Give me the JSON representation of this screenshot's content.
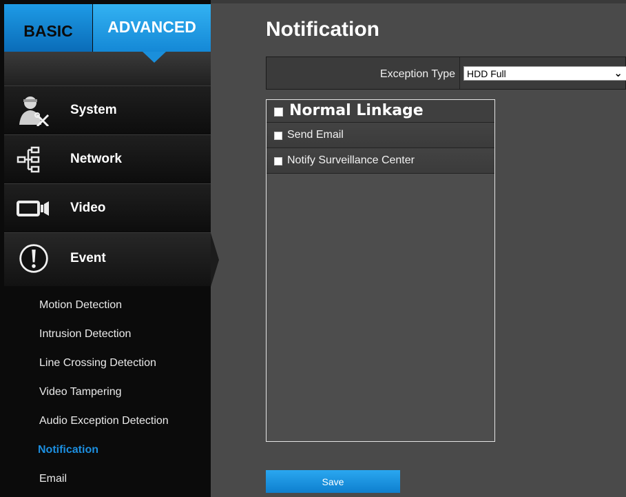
{
  "mode_tabs": {
    "basic": "BASIC",
    "advanced": "ADVANCED"
  },
  "nav": [
    {
      "label": "System",
      "icon": "admin-tools-icon"
    },
    {
      "label": "Network",
      "icon": "network-tree-icon"
    },
    {
      "label": "Video",
      "icon": "video-camera-icon"
    },
    {
      "label": "Event",
      "icon": "exclamation-circle-icon"
    }
  ],
  "event_submenu": [
    "Motion Detection",
    "Intrusion Detection",
    "Line Crossing Detection",
    "Video Tampering",
    "Audio Exception Detection",
    "Notification",
    "Email"
  ],
  "active_submenu": "Notification",
  "page": {
    "title": "Notification"
  },
  "exception": {
    "label": "Exception Type",
    "value": "HDD Full"
  },
  "linkage": {
    "title": "Normal Linkage",
    "options": [
      "Send Email",
      "Notify Surveillance Center"
    ]
  },
  "save_label": "Save",
  "colors": {
    "accent": "#1c8fe0",
    "background": "#4a4a4a",
    "sidebar": "#0b0b0b"
  }
}
